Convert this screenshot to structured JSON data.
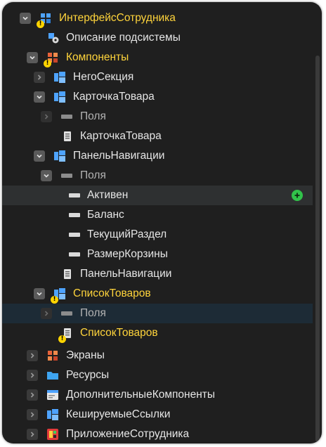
{
  "tree": {
    "root": {
      "label": "ИнтерфейсСотрудника",
      "icon": "interface-icon"
    },
    "subsystem_description": {
      "label": "Описание подсистемы",
      "icon": "settings-gear-icon"
    },
    "components": {
      "label": "Компоненты",
      "icon": "components-icon"
    },
    "nego_section": {
      "label": "НегоСекция",
      "icon": "component-icon"
    },
    "product_card": {
      "label": "КарточкаТовара",
      "icon": "component-icon"
    },
    "product_card_fields": {
      "label": "Поля",
      "icon": "fields-icon"
    },
    "product_card_doc": {
      "label": "КарточкаТовара",
      "icon": "document-icon"
    },
    "nav_panel": {
      "label": "ПанельНавигации",
      "icon": "component-icon"
    },
    "nav_panel_fields": {
      "label": "Поля",
      "icon": "fields-icon"
    },
    "field_active": {
      "label": "Активен",
      "icon": "field-icon",
      "action_icon": "add-icon"
    },
    "field_balance": {
      "label": "Баланс",
      "icon": "field-icon"
    },
    "field_current_section": {
      "label": "ТекущийРаздел",
      "icon": "field-icon"
    },
    "field_cart_size": {
      "label": "РазмерКорзины",
      "icon": "field-icon"
    },
    "nav_panel_doc": {
      "label": "ПанельНавигации",
      "icon": "document-icon"
    },
    "product_list": {
      "label": "СписокТоваров",
      "icon": "component-icon"
    },
    "product_list_fields": {
      "label": "Поля",
      "icon": "fields-icon"
    },
    "product_list_doc": {
      "label": "СписокТоваров",
      "icon": "document-icon"
    },
    "screens": {
      "label": "Экраны",
      "icon": "screens-icon"
    },
    "resources": {
      "label": "Ресурсы",
      "icon": "folder-icon"
    },
    "extra_components": {
      "label": "ДополнительныеКомпоненты",
      "icon": "window-icon"
    },
    "cached_links": {
      "label": "КешируемыеСсылки",
      "icon": "cached-links-icon"
    },
    "employee_app": {
      "label": "ПриложениеСотрудника",
      "icon": "app-icon"
    }
  },
  "warning_badge_text": "!",
  "colors": {
    "background": "#1f1f1f",
    "text": "#e6e6e6",
    "highlight_text": "#ffd43b",
    "hover_row": "#2e3031",
    "selected_row": "#1d2b36",
    "add_button": "#31c24a",
    "warning_badge": "#ffd400"
  }
}
